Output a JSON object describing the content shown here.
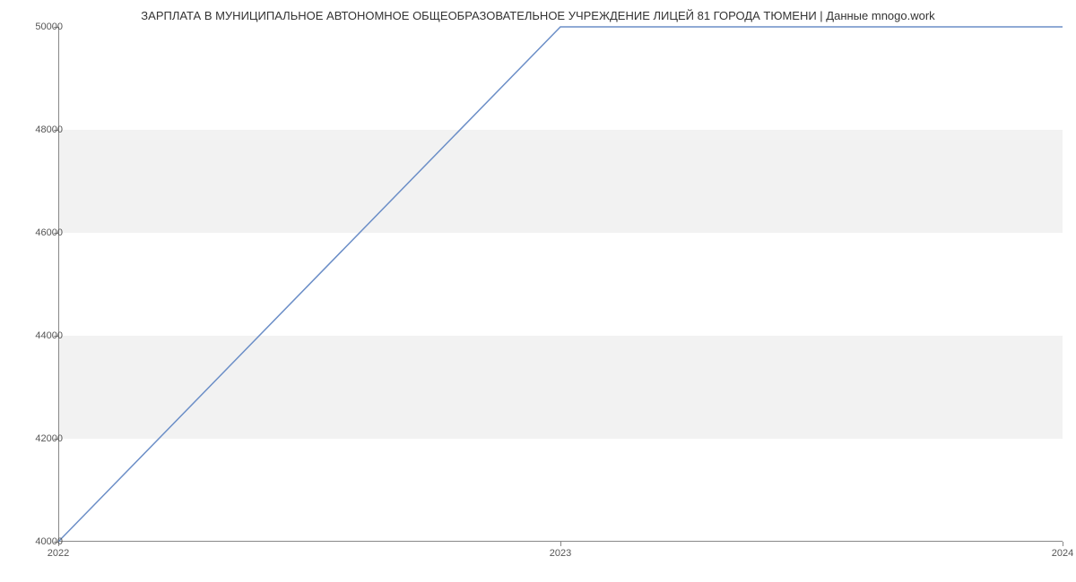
{
  "chart_data": {
    "type": "line",
    "title": "ЗАРПЛАТА В МУНИЦИПАЛЬНОЕ АВТОНОМНОЕ ОБЩЕОБРАЗОВАТЕЛЬНОЕ УЧРЕЖДЕНИЕ ЛИЦЕЙ 81 ГОРОДА ТЮМЕНИ | Данные mnogo.work",
    "x": [
      2022,
      2023,
      2024
    ],
    "values": [
      40000,
      50000,
      50000
    ],
    "xlabel": "",
    "ylabel": "",
    "xlim": [
      2022,
      2024
    ],
    "ylim": [
      40000,
      50000
    ],
    "y_ticks": [
      40000,
      42000,
      44000,
      46000,
      48000,
      50000
    ],
    "x_ticks": [
      2022,
      2023,
      2024
    ],
    "line_color": "#6b8ec7",
    "band_color": "#f2f2f2"
  }
}
